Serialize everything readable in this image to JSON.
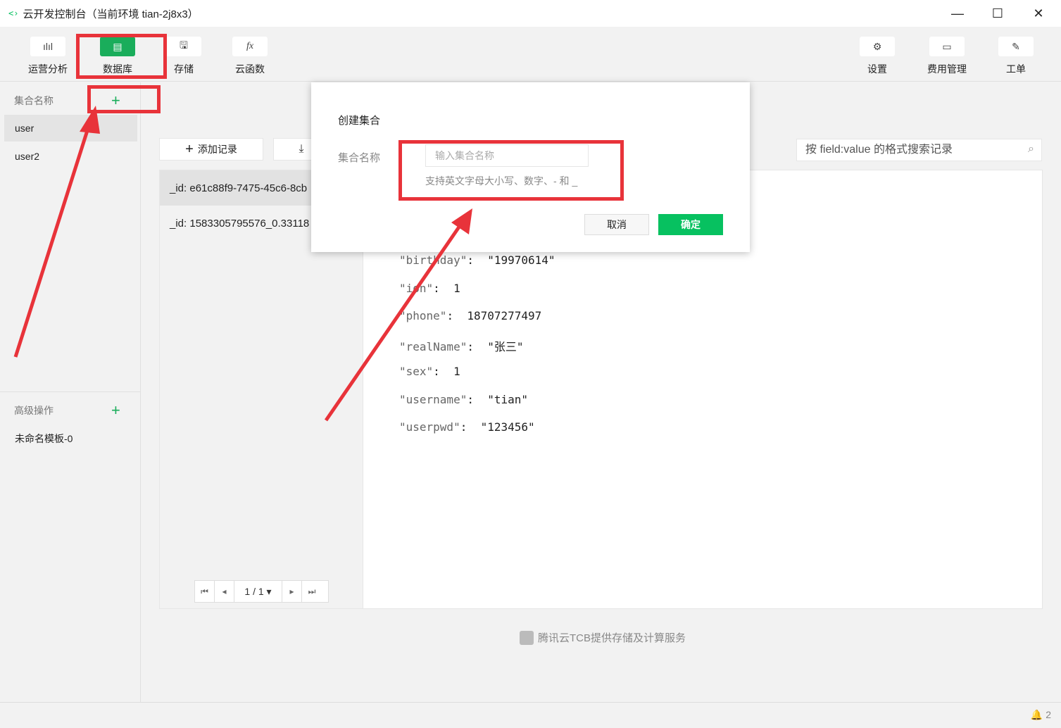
{
  "window": {
    "logo_glyph": "<›",
    "title": "云开发控制台（当前环境 tian-2j8x3）",
    "minimize_glyph": "—",
    "maximize_glyph": "☐",
    "close_glyph": "✕"
  },
  "toolbar": {
    "left": [
      {
        "label": "运营分析",
        "icon": "bar-chart-icon",
        "glyph": "ılıl"
      },
      {
        "label": "数据库",
        "icon": "database-icon",
        "glyph": "▤",
        "active": true
      },
      {
        "label": "存储",
        "icon": "floppy-disk-icon",
        "glyph": "🖫"
      },
      {
        "label": "云函数",
        "icon": "function-icon",
        "glyph": "fx"
      }
    ],
    "right": [
      {
        "label": "设置",
        "icon": "gear-icon",
        "glyph": "⚙"
      },
      {
        "label": "费用管理",
        "icon": "wallet-icon",
        "glyph": "▭"
      },
      {
        "label": "工单",
        "icon": "ticket-icon",
        "glyph": "✎"
      }
    ]
  },
  "sidebar": {
    "collections_header": "集合名称",
    "add_glyph": "+",
    "collections": [
      "user",
      "user2"
    ],
    "advanced_header": "高级操作",
    "templates": [
      "未命名模板-0"
    ]
  },
  "main": {
    "add_record_label": "添加记录",
    "add_record_glyph": "+",
    "download_glyph": "⤓",
    "search_placeholder": "按 field:value 的格式搜索记录",
    "search_glyph": "⌕",
    "records": [
      "_id: e61c88f9-7475-45c6-8cb",
      "_id: 1583305795576_0.33118"
    ],
    "pager": {
      "first": "⏮",
      "prev": "◂",
      "page": "1 / 1 ▾",
      "next": "▸",
      "last": "⏭"
    },
    "json_fields": [
      {
        "key": "\"birthday\"",
        "value": "\"19970614\""
      },
      {
        "key": "\"ion\"",
        "value": "1"
      },
      {
        "key": "\"phone\"",
        "value": "18707277497"
      },
      {
        "key": "\"realName\"",
        "value": "\"张三\""
      },
      {
        "key": "\"sex\"",
        "value": "1"
      },
      {
        "key": "\"username\"",
        "value": "\"tian\""
      },
      {
        "key": "\"userpwd\"",
        "value": "\"123456\""
      }
    ],
    "footer_brand": "腾讯云TCB提供存储及计算服务"
  },
  "status": {
    "bell_glyph": "🔔",
    "notification_count": "2"
  },
  "modal": {
    "title": "创建集合",
    "field_label": "集合名称",
    "input_placeholder": "输入集合名称",
    "hint": "支持英文字母大小写、数字、- 和 _",
    "cancel_label": "取消",
    "ok_label": "确定"
  },
  "colors": {
    "accent": "#07c160",
    "annotation": "#e8333a"
  }
}
